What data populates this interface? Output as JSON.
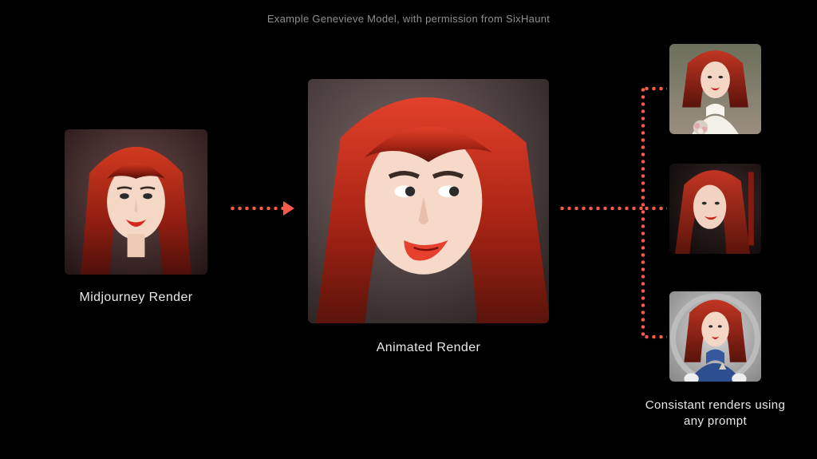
{
  "credit": "Example Genevieve Model, with permission from SixHaunt",
  "labels": {
    "source": "Midjourney Render",
    "center": "Animated Render",
    "outputs": "Consistant renders using\nany prompt"
  },
  "accent_color": "#fb5a4a",
  "images": {
    "source": {
      "alt": "Midjourney portrait render of a red-haired woman, frontal"
    },
    "center": {
      "alt": "Large animated render of the same red-haired woman, three-quarter view"
    },
    "out_top": {
      "alt": "Consistent render: red-haired woman in white dress with bouquet"
    },
    "out_mid": {
      "alt": "Consistent render: red-haired woman profile with red lipstick"
    },
    "out_bot": {
      "alt": "Consistent render: red-haired woman in blue Starfleet-style uniform"
    }
  }
}
